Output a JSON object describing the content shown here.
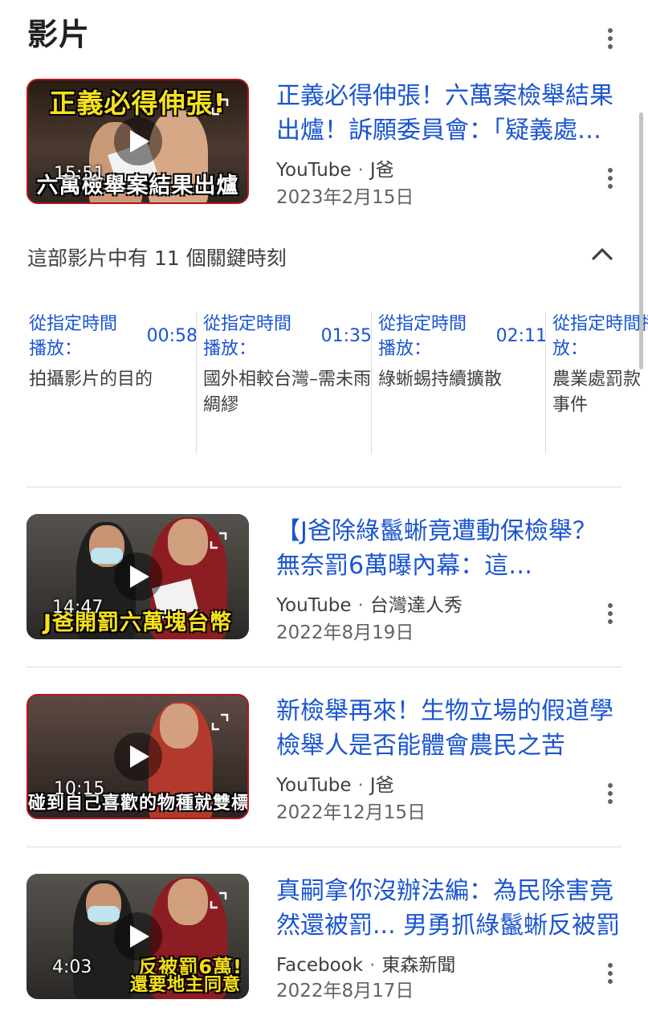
{
  "section": {
    "title": "影片"
  },
  "videos": [
    {
      "title": "正義必得伸張！六萬案檢舉結果出爐！訴願委員會：「疑義處分撤銷」",
      "source": "YouTube",
      "channel": "J爸",
      "date": "2023年2月15日",
      "duration": "15:51",
      "thumb_top": "正義必得伸張!",
      "thumb_bottom": "六萬檢舉案結果出爐"
    },
    {
      "title": "【J爸除綠鬣蜥竟遭動保檢舉？ 無奈罰6萬曝內幕：這…",
      "source": "YouTube",
      "channel": "台灣達人秀",
      "date": "2022年8月19日",
      "duration": "14:47",
      "thumb_bottom": "J爸開罰六萬塊台幣"
    },
    {
      "title": "新檢舉再來！生物立場的假道學檢舉人是否能體會農民之苦",
      "source": "YouTube",
      "channel": "J爸",
      "date": "2022年12月15日",
      "duration": "10:15",
      "thumb_bottom": "碰到自己喜歡的物種就雙標?"
    },
    {
      "title": "真嗣拿你沒辦法編：為民除害竟然還被罰... 男勇抓綠鬣蜥反被罰",
      "source": "Facebook",
      "channel": "東森新聞",
      "date": "2022年8月17日",
      "duration": "4:03",
      "thumb_top": "反被罰6萬!",
      "thumb_bottom": "還要地主同意"
    }
  ],
  "key_moments": {
    "header": "這部影片中有 11 個關鍵時刻",
    "items": [
      {
        "from_label": "從指定時間播放：",
        "time": "00:58",
        "desc": "拍攝影片的目的"
      },
      {
        "from_label": "從指定時間播放：",
        "time": "01:35",
        "desc": "國外相較台灣–需未雨綢繆"
      },
      {
        "from_label": "從指定時間播放：",
        "time": "02:11",
        "desc": "綠蜥蜴持續擴散"
      },
      {
        "from_label": "從指定時間播放：",
        "time": "",
        "desc": "農業處罰款事件"
      }
    ]
  },
  "colors": {
    "link": "#1a55d0",
    "text": "#202124",
    "secondary": "#5f6368"
  },
  "icons": [
    "play-icon",
    "expand-icon",
    "more-vert-icon",
    "chevron-up-icon"
  ]
}
